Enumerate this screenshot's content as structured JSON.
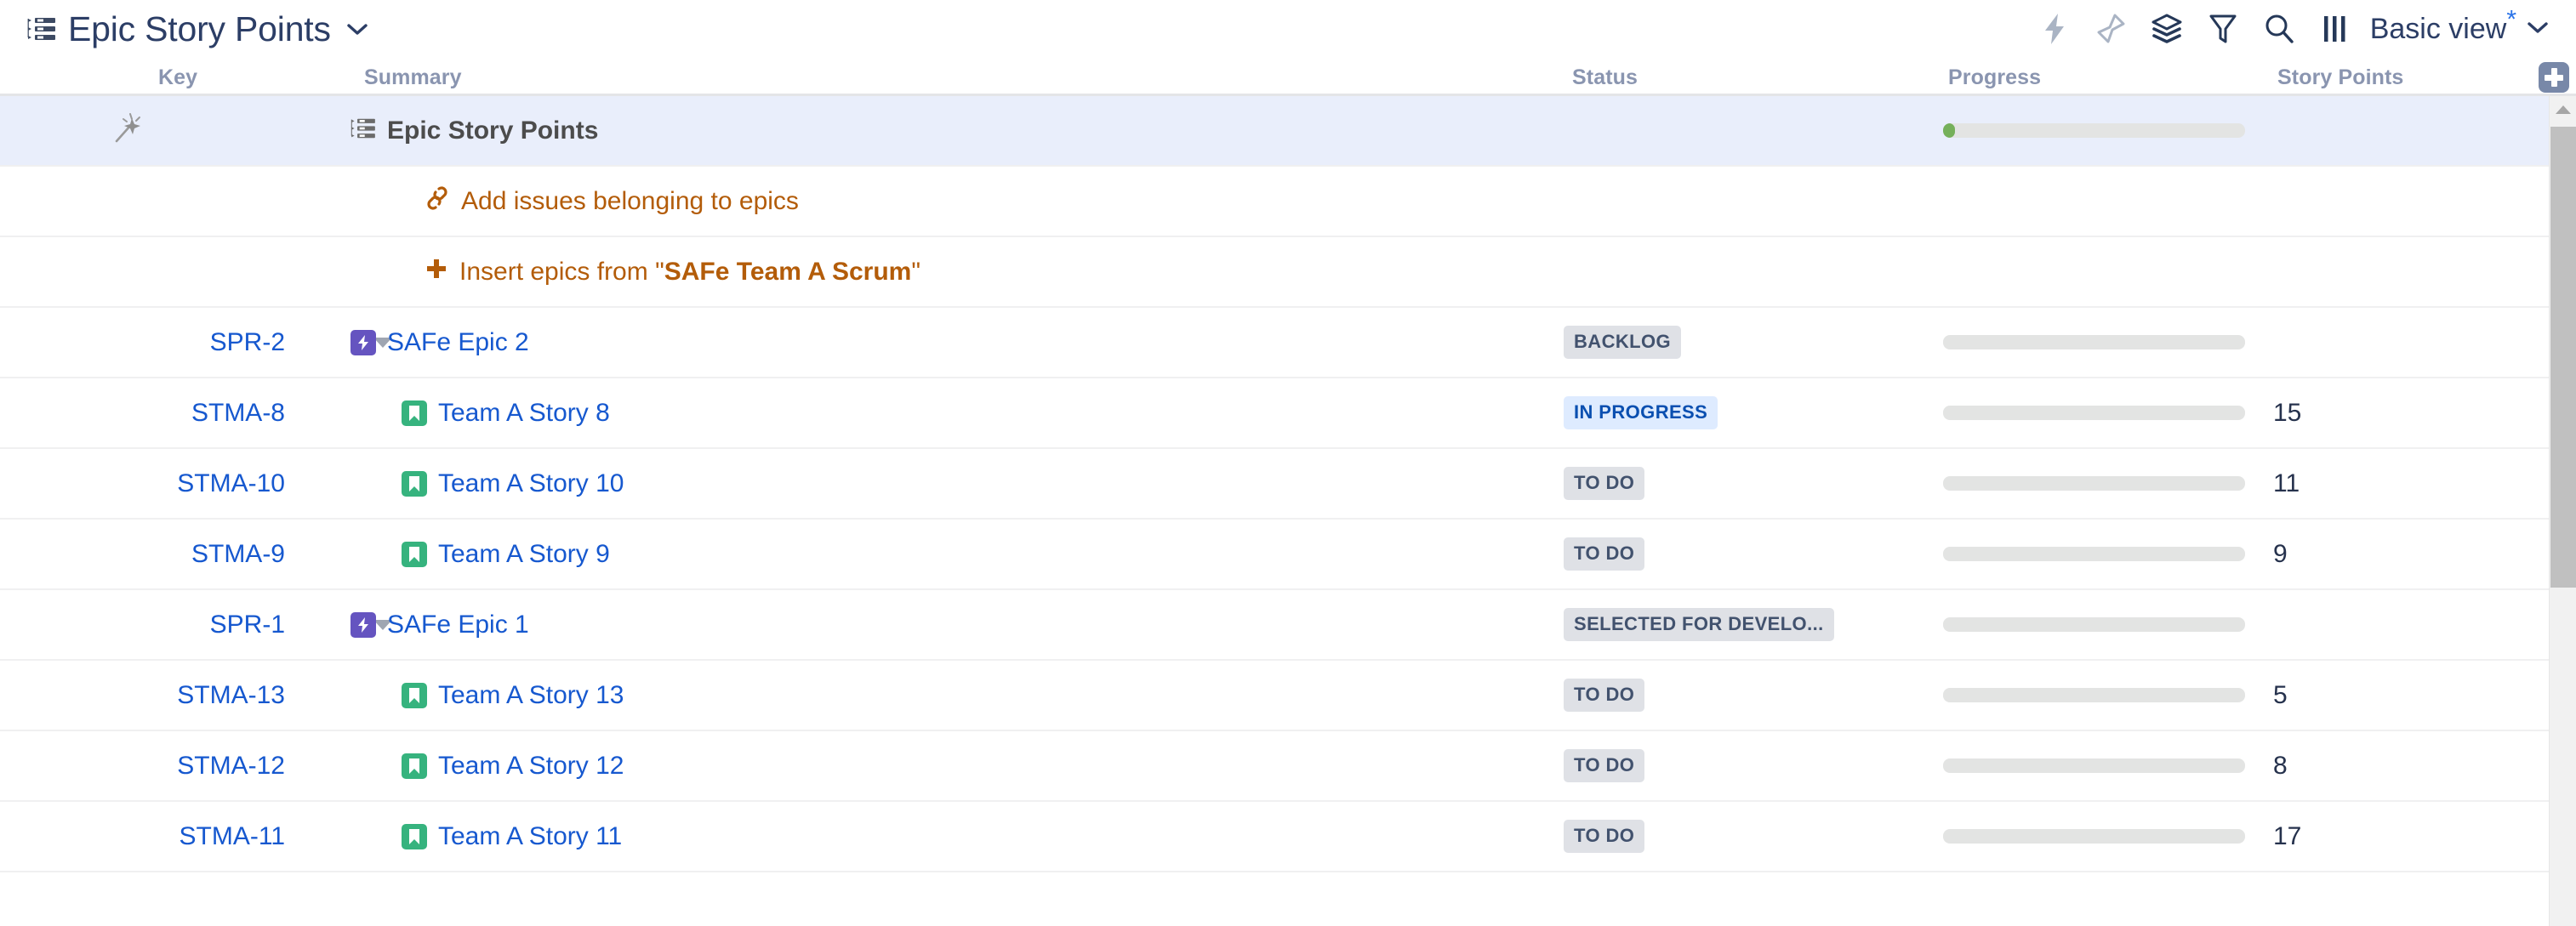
{
  "header": {
    "title": "Epic Story Points",
    "structure_icon": "structure-list-icon",
    "title_chevron_icon": "chevron-down-icon",
    "toolbar": [
      {
        "name": "automation-icon",
        "glyph": "lightning-bolt-icon",
        "state": "disabled"
      },
      {
        "name": "pin-icon",
        "glyph": "pin-icon",
        "state": "disabled"
      },
      {
        "name": "group-layers-icon",
        "glyph": "layers-icon",
        "state": "enabled"
      },
      {
        "name": "filter-icon",
        "glyph": "funnel-icon",
        "state": "enabled"
      },
      {
        "name": "search-icon",
        "glyph": "magnifier-icon",
        "state": "enabled"
      },
      {
        "name": "columns-icon",
        "glyph": "columns-bars-icon",
        "state": "enabled"
      }
    ],
    "view_label": "Basic view",
    "view_modified_marker": "*",
    "view_chevron_icon": "chevron-down-icon"
  },
  "columns": {
    "key": "Key",
    "summary": "Summary",
    "status": "Status",
    "progress": "Progress",
    "story_points": "Story Points",
    "add_column": "+"
  },
  "rows": [
    {
      "type": "root",
      "key": "",
      "icon": "structure-list-icon",
      "wand_icon": "magic-wand-icon",
      "summary": "Epic Story Points",
      "status": "",
      "progress_percent": 4,
      "story_points": "",
      "highlighted": true,
      "indent": 0
    },
    {
      "type": "action",
      "icon": "link-chain-icon",
      "label": "Add issues belonging to epics",
      "indent": 1
    },
    {
      "type": "action",
      "icon": "plus-icon",
      "label_prefix": "Insert epics from \"",
      "label_bold": "SAFe Team A Scrum",
      "label_suffix": "\"",
      "indent": 1
    },
    {
      "type": "epic",
      "key": "SPR-2",
      "icon": "epic-icon",
      "toggle_icon": "triangle-down-icon",
      "summary": "SAFe Epic 2",
      "status": "BACKLOG",
      "status_variant": "default",
      "progress_percent": 0,
      "story_points": "",
      "indent": 1
    },
    {
      "type": "story",
      "key": "STMA-8",
      "icon": "story-icon",
      "summary": "Team A Story 8",
      "status": "IN PROGRESS",
      "status_variant": "inprogress",
      "progress_percent": 0,
      "story_points": "15",
      "indent": 2
    },
    {
      "type": "story",
      "key": "STMA-10",
      "icon": "story-icon",
      "summary": "Team A Story 10",
      "status": "TO DO",
      "status_variant": "default",
      "progress_percent": 0,
      "story_points": "11",
      "indent": 2
    },
    {
      "type": "story",
      "key": "STMA-9",
      "icon": "story-icon",
      "summary": "Team A Story 9",
      "status": "TO DO",
      "status_variant": "default",
      "progress_percent": 0,
      "story_points": "9",
      "indent": 2
    },
    {
      "type": "epic",
      "key": "SPR-1",
      "icon": "epic-icon",
      "toggle_icon": "triangle-down-icon",
      "summary": "SAFe Epic 1",
      "status": "SELECTED FOR DEVELO...",
      "status_variant": "default",
      "progress_percent": 0,
      "story_points": "",
      "indent": 1
    },
    {
      "type": "story",
      "key": "STMA-13",
      "icon": "story-icon",
      "summary": "Team A Story 13",
      "status": "TO DO",
      "status_variant": "default",
      "progress_percent": 0,
      "story_points": "5",
      "indent": 2
    },
    {
      "type": "story",
      "key": "STMA-12",
      "icon": "story-icon",
      "summary": "Team A Story 12",
      "status": "TO DO",
      "status_variant": "default",
      "progress_percent": 0,
      "story_points": "8",
      "indent": 2
    },
    {
      "type": "story",
      "key": "STMA-11",
      "icon": "story-icon",
      "summary": "Team A Story 11",
      "status": "TO DO",
      "status_variant": "default",
      "progress_percent": 0,
      "story_points": "17",
      "indent": 2
    }
  ],
  "colors": {
    "link": "#1658cf",
    "action_text": "#b35c09",
    "epic_icon": "#6554c0",
    "story_icon": "#36b37e",
    "progress_fill": "#75b05a",
    "row_highlight": "#e9eefb",
    "badge_default_bg": "#dfe1e6",
    "badge_default_text": "#42526e",
    "badge_inprogress_bg": "#deebff",
    "badge_inprogress_text": "#0a4fb0",
    "header_text": "#8a95b0",
    "title_text": "#2c3e66"
  },
  "scrollbar": {
    "up_arrow_icon": "triangle-up-icon",
    "thumb_label": "vertical-scroll-thumb"
  }
}
